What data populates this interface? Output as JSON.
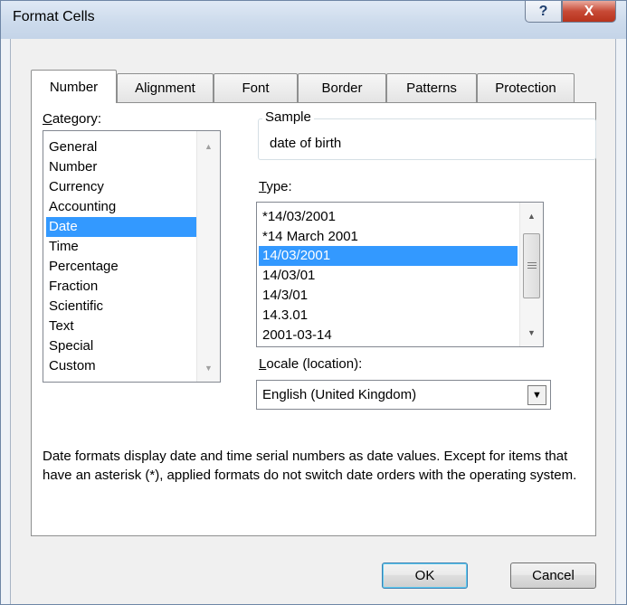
{
  "window": {
    "title": "Format Cells",
    "help_glyph": "?",
    "close_glyph": "X"
  },
  "tabs": [
    {
      "label": "Number",
      "active": true
    },
    {
      "label": "Alignment"
    },
    {
      "label": "Font"
    },
    {
      "label": "Border"
    },
    {
      "label": "Patterns"
    },
    {
      "label": "Protection"
    }
  ],
  "category": {
    "label_accel": "C",
    "label_rest": "ategory:",
    "items": [
      "General",
      "Number",
      "Currency",
      "Accounting",
      "Date",
      "Time",
      "Percentage",
      "Fraction",
      "Scientific",
      "Text",
      "Special",
      "Custom"
    ],
    "selected": "Date"
  },
  "sample": {
    "legend": "Sample",
    "value": "date of birth"
  },
  "type": {
    "label_accel": "T",
    "label_rest": "ype:",
    "items": [
      "*14/03/2001",
      "*14 March 2001",
      "14/03/2001",
      "14/03/01",
      "14/3/01",
      "14.3.01",
      "2001-03-14"
    ],
    "selected": "14/03/2001"
  },
  "locale": {
    "label_accel": "L",
    "label_rest": "ocale (location):",
    "value": "English (United Kingdom)"
  },
  "description": "Date formats display date and time serial numbers as date values. Except for items that have an asterisk (*), applied formats do not switch date orders with the operating system.",
  "buttons": {
    "ok": "OK",
    "cancel": "Cancel"
  },
  "colors": {
    "selection": "#3399ff",
    "close_button": "#c74a36"
  }
}
